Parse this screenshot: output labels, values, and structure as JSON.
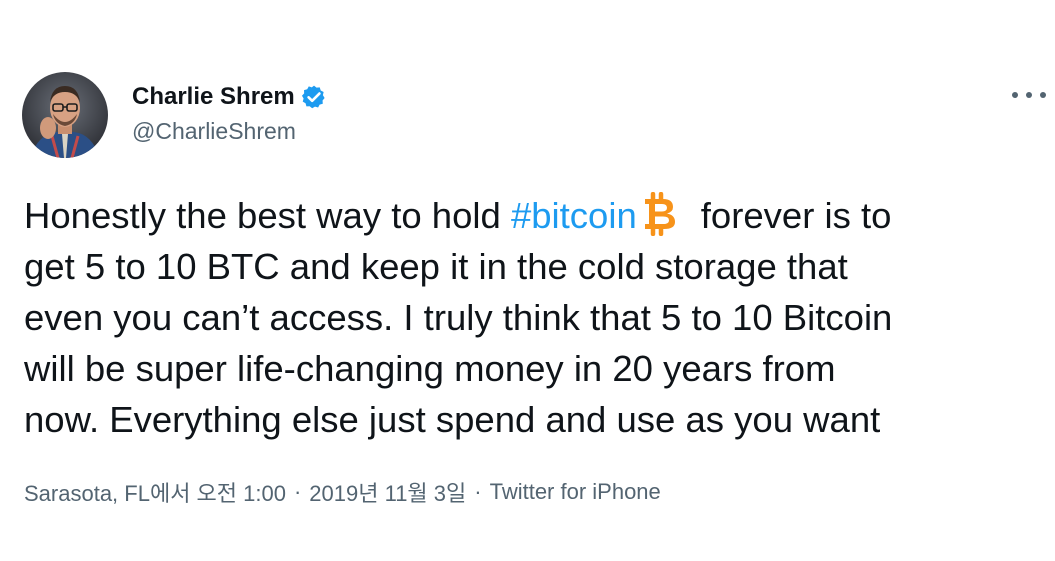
{
  "author": {
    "display_name": "Charlie Shrem",
    "handle": "@CharlieShrem",
    "verified": true
  },
  "tweet": {
    "line1_before": "Honestly the best way to hold ",
    "hashtag": "#bitcoin",
    "emoji": "bitcoin-emoji",
    "line1_after": "forever is to",
    "line2": "get 5 to 10 BTC and keep it in the cold storage that",
    "line3": "even you can’t access. I truly think that 5 to 10 Bitcoin",
    "line4": "will be super life-changing money in 20 years from",
    "line5": "now. Everything else just spend and use as you want"
  },
  "meta": {
    "timestamp": "Sarasota, FL에서 오전 1:00",
    "separator": "·",
    "date": "2019년 11월 3일",
    "source": "Twitter for iPhone"
  },
  "colors": {
    "link": "#1d9bf0",
    "secondary_text": "#536471",
    "primary_text": "#0f1419",
    "bitcoin_orange": "#f7931a"
  }
}
